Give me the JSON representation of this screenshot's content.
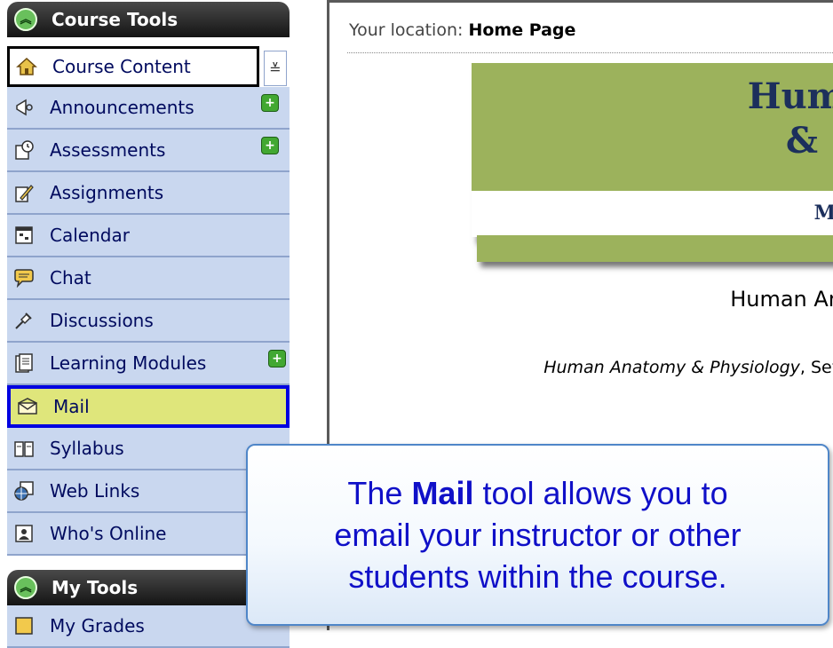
{
  "sidebar": {
    "course_tools_title": "Course Tools",
    "items": [
      {
        "label": "Course Content",
        "icon": "home-icon",
        "new": false
      },
      {
        "label": "Announcements",
        "icon": "megaphone-icon",
        "new": true
      },
      {
        "label": "Assessments",
        "icon": "stopwatch-icon",
        "new": true
      },
      {
        "label": "Assignments",
        "icon": "pencil-paper-icon",
        "new": false
      },
      {
        "label": "Calendar",
        "icon": "calendar-icon",
        "new": false
      },
      {
        "label": "Chat",
        "icon": "speech-bubble-icon",
        "new": false
      },
      {
        "label": "Discussions",
        "icon": "pushpin-icon",
        "new": false
      },
      {
        "label": "Learning Modules",
        "icon": "document-icon",
        "new": true
      },
      {
        "label": "Mail",
        "icon": "envelope-icon",
        "new": false
      },
      {
        "label": "Syllabus",
        "icon": "book-icon",
        "new": false
      },
      {
        "label": "Web Links",
        "icon": "globe-icon",
        "new": false
      },
      {
        "label": "Who's Online",
        "icon": "person-frame-icon",
        "new": false
      }
    ],
    "my_tools_title": "My Tools",
    "my_tools_items": [
      {
        "label": "My Grades",
        "icon": "grades-icon"
      }
    ],
    "new_badge": "+"
  },
  "content": {
    "location_prefix": "Your location:",
    "location_value": "Home Page",
    "banner_line1": "Hum",
    "banner_line2": "&",
    "banner_sub": "M",
    "course_heading": "Human An",
    "course_text_italic": "Human Anatomy & Physiology",
    "course_text_rest": ", Sev"
  },
  "callout": {
    "part1": "The ",
    "bold": "Mail",
    "part2": " tool allows you to",
    "line2": "email your instructor or other",
    "line3": "students within the course."
  },
  "colors": {
    "sidebar_item": "#c9d7ef",
    "selected_item": "#dfe67b",
    "selected_border": "#0000e0",
    "banner_green": "#9cb25c",
    "callout_text": "#1010c8"
  }
}
